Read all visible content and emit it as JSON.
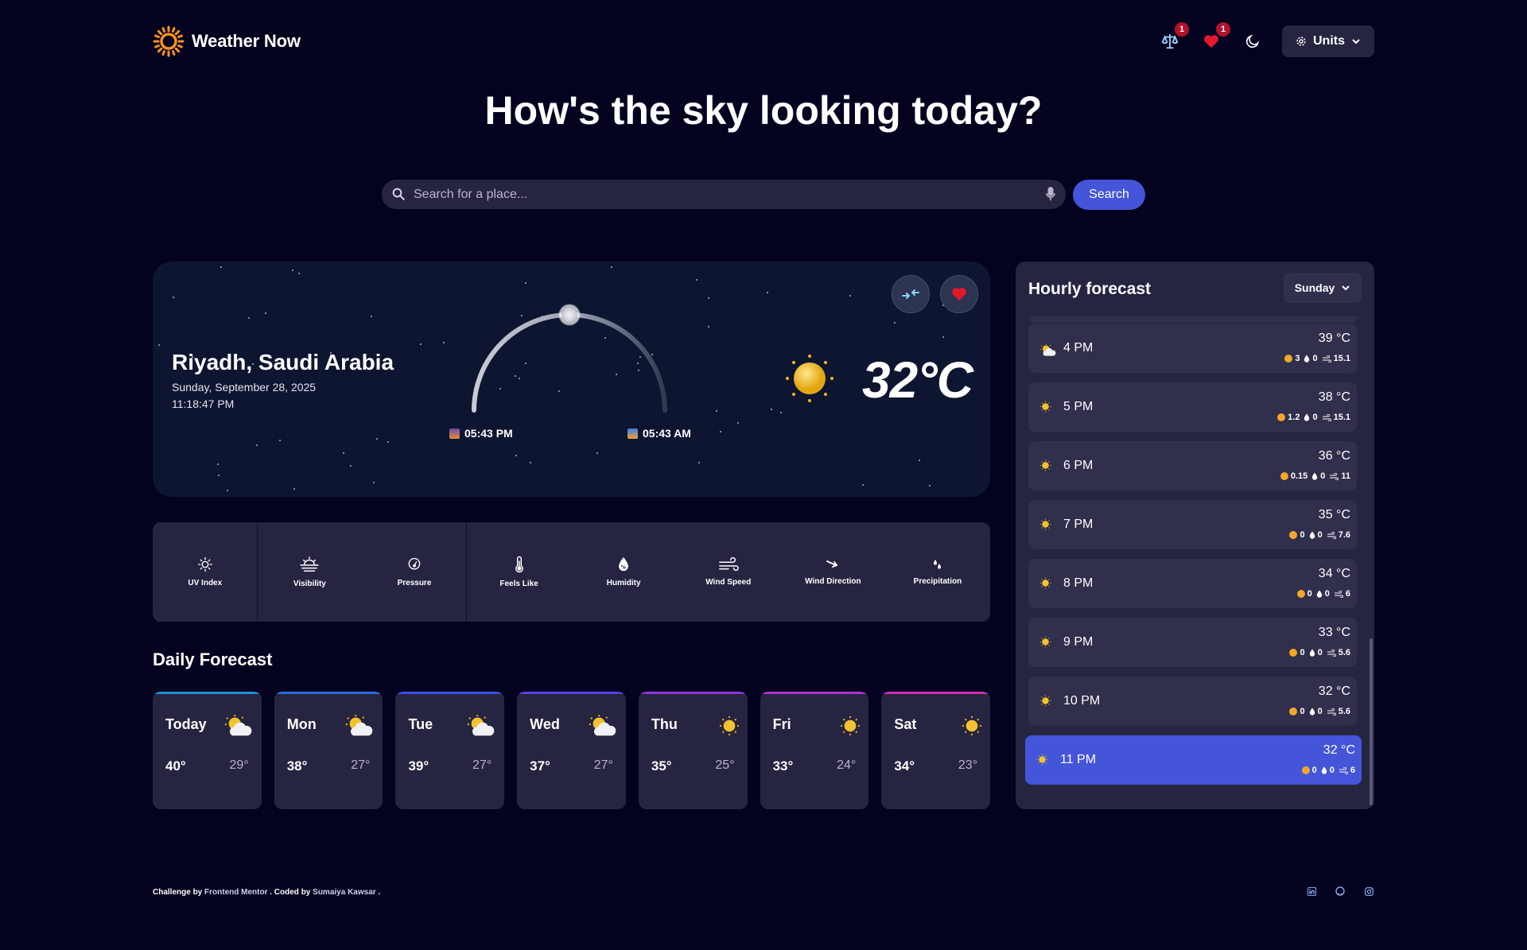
{
  "app": {
    "title": "Weather Now"
  },
  "header": {
    "compare_badge": "1",
    "favorites_badge": "1",
    "units_label": "Units"
  },
  "hero": {
    "heading": "How's the sky looking today?"
  },
  "search": {
    "placeholder": "Search for a place...",
    "button_label": "Search"
  },
  "current": {
    "city": "Riyadh, Saudi Arabia",
    "date": "Sunday, September 28, 2025",
    "time": "11:18:47 PM",
    "sunset": "05:43 PM",
    "sunrise": "05:43 AM",
    "temperature": "32°C",
    "icon": "sun-icon",
    "sun_progress": 0.5
  },
  "metrics": [
    {
      "label": "UV Index",
      "icon": "uv-index-icon"
    },
    {
      "label": "Visibility",
      "icon": "visibility-icon"
    },
    {
      "label": "Pressure",
      "icon": "pressure-icon"
    },
    {
      "label": "Feels Like",
      "icon": "thermometer-icon"
    },
    {
      "label": "Humidity",
      "icon": "humidity-icon"
    },
    {
      "label": "Wind Speed",
      "icon": "wind-icon"
    },
    {
      "label": "Wind Direction",
      "icon": "wind-direction-icon"
    },
    {
      "label": "Precipitation",
      "icon": "precipitation-icon"
    }
  ],
  "daily": {
    "title": "Daily Forecast",
    "days": [
      {
        "name": "Today",
        "hi": "40°",
        "lo": "29°",
        "icon": "partly-cloudy-icon",
        "accent": "#1f8fd6"
      },
      {
        "name": "Mon",
        "hi": "38°",
        "lo": "27°",
        "icon": "partly-cloudy-icon",
        "accent": "#2a6fe0"
      },
      {
        "name": "Tue",
        "hi": "39°",
        "lo": "27°",
        "icon": "partly-cloudy-icon",
        "accent": "#3c4fe6"
      },
      {
        "name": "Wed",
        "hi": "37°",
        "lo": "27°",
        "icon": "partly-cloudy-icon",
        "accent": "#5a3fe4"
      },
      {
        "name": "Thu",
        "hi": "35°",
        "lo": "25°",
        "icon": "sun-icon",
        "accent": "#8d35dc"
      },
      {
        "name": "Fri",
        "hi": "33°",
        "lo": "24°",
        "icon": "sun-icon",
        "accent": "#b22fd0"
      },
      {
        "name": "Sat",
        "hi": "34°",
        "lo": "23°",
        "icon": "sun-icon",
        "accent": "#d12fb6"
      }
    ]
  },
  "hourly": {
    "title": "Hourly forecast",
    "selected_day": "Sunday",
    "hours": [
      {
        "time": "4 PM",
        "temp": "39 °C",
        "uv": "3",
        "precip": "0",
        "wind": "15.1",
        "icon": "partly-cloudy-icon"
      },
      {
        "time": "5 PM",
        "temp": "38 °C",
        "uv": "1.2",
        "precip": "0",
        "wind": "15.1",
        "icon": "sun-icon"
      },
      {
        "time": "6 PM",
        "temp": "36 °C",
        "uv": "0.15",
        "precip": "0",
        "wind": "11",
        "icon": "sun-icon"
      },
      {
        "time": "7 PM",
        "temp": "35 °C",
        "uv": "0",
        "precip": "0",
        "wind": "7.6",
        "icon": "sun-icon"
      },
      {
        "time": "8 PM",
        "temp": "34 °C",
        "uv": "0",
        "precip": "0",
        "wind": "6",
        "icon": "sun-icon"
      },
      {
        "time": "9 PM",
        "temp": "33 °C",
        "uv": "0",
        "precip": "0",
        "wind": "5.6",
        "icon": "sun-icon"
      },
      {
        "time": "10 PM",
        "temp": "32 °C",
        "uv": "0",
        "precip": "0",
        "wind": "5.6",
        "icon": "sun-icon"
      },
      {
        "time": "11 PM",
        "temp": "32 °C",
        "uv": "0",
        "precip": "0",
        "wind": "6",
        "icon": "sun-icon",
        "active": true
      }
    ]
  },
  "footer": {
    "prefix": "Challenge by",
    "link1": "Frontend Mentor",
    "middle": ". Coded by",
    "link2": "Sumaiya Kawsar",
    "suffix": "."
  },
  "colors": {
    "background": "#03021f",
    "card": "#262541",
    "accent": "#4455da",
    "badge": "#b3122a"
  }
}
